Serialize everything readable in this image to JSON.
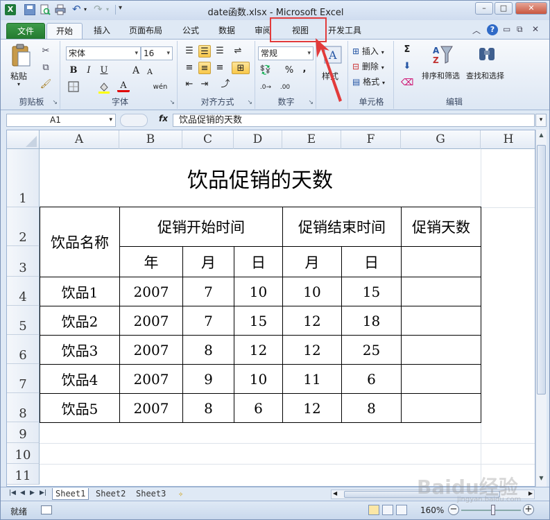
{
  "window": {
    "title": "date函数.xlsx  -  Microsoft Excel",
    "min": "–",
    "max": "□",
    "close": "✕"
  },
  "ribbon_tabs": {
    "file": "文件",
    "home": "开始",
    "insert": "插入",
    "layout": "页面布局",
    "formulas": "公式",
    "data": "数据",
    "review": "审阅",
    "view": "视图",
    "developer": "开发工具"
  },
  "ribbon": {
    "clipboard": {
      "label": "剪贴板",
      "paste": "粘贴"
    },
    "font": {
      "label": "字体",
      "name": "宋体",
      "size": "16",
      "bold": "B",
      "italic": "I",
      "underline": "U",
      "grow": "A",
      "shrink": "A",
      "color_letter": "A",
      "wen": "wén"
    },
    "align": {
      "label": "对齐方式"
    },
    "number": {
      "label": "数字",
      "format": "常规",
      "pct": "%",
      "comma": ","
    },
    "styles": {
      "label": "样式"
    },
    "cells": {
      "label": "单元格",
      "insert": "插入",
      "delete": "删除",
      "format": "格式"
    },
    "editing": {
      "label": "编辑",
      "sort": "排序和筛选",
      "find": "查找和选择",
      "sigma": "Σ"
    }
  },
  "formula_bar": {
    "cell_ref": "A1",
    "fx": "fx",
    "content": "饮品促销的天数"
  },
  "columns": [
    "A",
    "B",
    "C",
    "D",
    "E",
    "F",
    "G",
    "H"
  ],
  "rows": [
    "1",
    "2",
    "3",
    "4",
    "5",
    "6",
    "7",
    "8",
    "9",
    "10",
    "11"
  ],
  "sheet": {
    "title": "饮品促销的天数",
    "h_name": "饮品名称",
    "h_start": "促销开始时间",
    "h_end": "促销结束时间",
    "h_days": "促销天数",
    "h_year": "年",
    "h_month": "月",
    "h_day": "日",
    "h_month2": "月",
    "h_day2": "日",
    "data": [
      {
        "name": "饮品1",
        "year": "2007",
        "m1": "7",
        "d1": "10",
        "m2": "10",
        "d2": "15"
      },
      {
        "name": "饮品2",
        "year": "2007",
        "m1": "7",
        "d1": "15",
        "m2": "12",
        "d2": "18"
      },
      {
        "name": "饮品3",
        "year": "2007",
        "m1": "8",
        "d1": "12",
        "m2": "12",
        "d2": "25"
      },
      {
        "name": "饮品4",
        "year": "2007",
        "m1": "9",
        "d1": "10",
        "m2": "11",
        "d2": "6"
      },
      {
        "name": "饮品5",
        "year": "2007",
        "m1": "8",
        "d1": "6",
        "m2": "12",
        "d2": "8"
      }
    ]
  },
  "sheet_tabs": [
    "Sheet1",
    "Sheet2",
    "Sheet3"
  ],
  "status": {
    "ready": "就绪",
    "zoom": "160%",
    "minus": "−",
    "plus": "+"
  },
  "watermark": {
    "main": "Baidu经验",
    "sub": "jingyan.baidu.com"
  },
  "colors": {
    "accent": "#e23b3b",
    "file_tab": "#237a2f"
  }
}
